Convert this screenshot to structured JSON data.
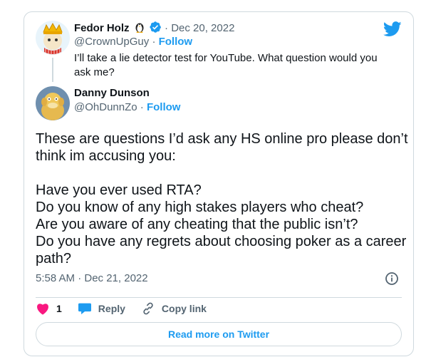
{
  "parent_tweet": {
    "author_name": "Fedor Holz",
    "author_handle": "@CrownUpGuy",
    "follow_label": "Follow",
    "date": "Dec 20, 2022",
    "text": "I’ll take a lie detector test for YouTube. What question would you ask me?"
  },
  "reply_tweet": {
    "author_name": "Danny Dunson",
    "author_handle": "@OhDunnZo",
    "follow_label": "Follow",
    "text": "These are questions I’d ask any HS online pro please don’t think im accusing you:\n\nHave you ever used RTA?\nDo you know of any high stakes players who cheat?\nAre you aware of any cheating that the public isn’t?\nDo you have any regrets about choosing poker as a career path?",
    "timestamp": "5:58 AM · Dec 21, 2022"
  },
  "actions": {
    "like_count": "1",
    "reply_label": "Reply",
    "copy_link_label": "Copy link"
  },
  "read_more_label": "Read more on Twitter",
  "separator": "·",
  "colors": {
    "accent": "#1d9bf0",
    "like": "#f91880",
    "muted": "#536471",
    "border": "#cfd9de"
  },
  "icons": [
    "twitter-bird-icon",
    "penguin-icon",
    "verified-badge-icon",
    "info-icon",
    "heart-icon",
    "reply-bubble-icon",
    "link-icon"
  ]
}
